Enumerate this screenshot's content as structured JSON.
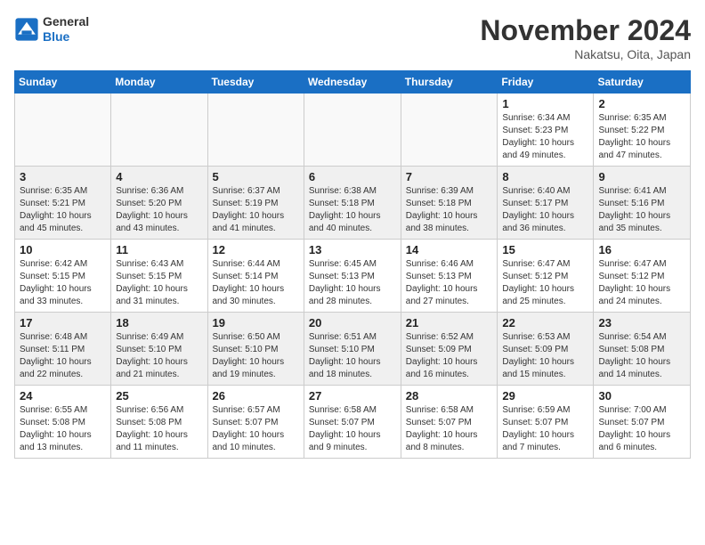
{
  "logo": {
    "general": "General",
    "blue": "Blue"
  },
  "header": {
    "month": "November 2024",
    "location": "Nakatsu, Oita, Japan"
  },
  "weekdays": [
    "Sunday",
    "Monday",
    "Tuesday",
    "Wednesday",
    "Thursday",
    "Friday",
    "Saturday"
  ],
  "weeks": [
    [
      {
        "day": "",
        "info": ""
      },
      {
        "day": "",
        "info": ""
      },
      {
        "day": "",
        "info": ""
      },
      {
        "day": "",
        "info": ""
      },
      {
        "day": "",
        "info": ""
      },
      {
        "day": "1",
        "info": "Sunrise: 6:34 AM\nSunset: 5:23 PM\nDaylight: 10 hours and 49 minutes."
      },
      {
        "day": "2",
        "info": "Sunrise: 6:35 AM\nSunset: 5:22 PM\nDaylight: 10 hours and 47 minutes."
      }
    ],
    [
      {
        "day": "3",
        "info": "Sunrise: 6:35 AM\nSunset: 5:21 PM\nDaylight: 10 hours and 45 minutes."
      },
      {
        "day": "4",
        "info": "Sunrise: 6:36 AM\nSunset: 5:20 PM\nDaylight: 10 hours and 43 minutes."
      },
      {
        "day": "5",
        "info": "Sunrise: 6:37 AM\nSunset: 5:19 PM\nDaylight: 10 hours and 41 minutes."
      },
      {
        "day": "6",
        "info": "Sunrise: 6:38 AM\nSunset: 5:18 PM\nDaylight: 10 hours and 40 minutes."
      },
      {
        "day": "7",
        "info": "Sunrise: 6:39 AM\nSunset: 5:18 PM\nDaylight: 10 hours and 38 minutes."
      },
      {
        "day": "8",
        "info": "Sunrise: 6:40 AM\nSunset: 5:17 PM\nDaylight: 10 hours and 36 minutes."
      },
      {
        "day": "9",
        "info": "Sunrise: 6:41 AM\nSunset: 5:16 PM\nDaylight: 10 hours and 35 minutes."
      }
    ],
    [
      {
        "day": "10",
        "info": "Sunrise: 6:42 AM\nSunset: 5:15 PM\nDaylight: 10 hours and 33 minutes."
      },
      {
        "day": "11",
        "info": "Sunrise: 6:43 AM\nSunset: 5:15 PM\nDaylight: 10 hours and 31 minutes."
      },
      {
        "day": "12",
        "info": "Sunrise: 6:44 AM\nSunset: 5:14 PM\nDaylight: 10 hours and 30 minutes."
      },
      {
        "day": "13",
        "info": "Sunrise: 6:45 AM\nSunset: 5:13 PM\nDaylight: 10 hours and 28 minutes."
      },
      {
        "day": "14",
        "info": "Sunrise: 6:46 AM\nSunset: 5:13 PM\nDaylight: 10 hours and 27 minutes."
      },
      {
        "day": "15",
        "info": "Sunrise: 6:47 AM\nSunset: 5:12 PM\nDaylight: 10 hours and 25 minutes."
      },
      {
        "day": "16",
        "info": "Sunrise: 6:47 AM\nSunset: 5:12 PM\nDaylight: 10 hours and 24 minutes."
      }
    ],
    [
      {
        "day": "17",
        "info": "Sunrise: 6:48 AM\nSunset: 5:11 PM\nDaylight: 10 hours and 22 minutes."
      },
      {
        "day": "18",
        "info": "Sunrise: 6:49 AM\nSunset: 5:10 PM\nDaylight: 10 hours and 21 minutes."
      },
      {
        "day": "19",
        "info": "Sunrise: 6:50 AM\nSunset: 5:10 PM\nDaylight: 10 hours and 19 minutes."
      },
      {
        "day": "20",
        "info": "Sunrise: 6:51 AM\nSunset: 5:10 PM\nDaylight: 10 hours and 18 minutes."
      },
      {
        "day": "21",
        "info": "Sunrise: 6:52 AM\nSunset: 5:09 PM\nDaylight: 10 hours and 16 minutes."
      },
      {
        "day": "22",
        "info": "Sunrise: 6:53 AM\nSunset: 5:09 PM\nDaylight: 10 hours and 15 minutes."
      },
      {
        "day": "23",
        "info": "Sunrise: 6:54 AM\nSunset: 5:08 PM\nDaylight: 10 hours and 14 minutes."
      }
    ],
    [
      {
        "day": "24",
        "info": "Sunrise: 6:55 AM\nSunset: 5:08 PM\nDaylight: 10 hours and 13 minutes."
      },
      {
        "day": "25",
        "info": "Sunrise: 6:56 AM\nSunset: 5:08 PM\nDaylight: 10 hours and 11 minutes."
      },
      {
        "day": "26",
        "info": "Sunrise: 6:57 AM\nSunset: 5:07 PM\nDaylight: 10 hours and 10 minutes."
      },
      {
        "day": "27",
        "info": "Sunrise: 6:58 AM\nSunset: 5:07 PM\nDaylight: 10 hours and 9 minutes."
      },
      {
        "day": "28",
        "info": "Sunrise: 6:58 AM\nSunset: 5:07 PM\nDaylight: 10 hours and 8 minutes."
      },
      {
        "day": "29",
        "info": "Sunrise: 6:59 AM\nSunset: 5:07 PM\nDaylight: 10 hours and 7 minutes."
      },
      {
        "day": "30",
        "info": "Sunrise: 7:00 AM\nSunset: 5:07 PM\nDaylight: 10 hours and 6 minutes."
      }
    ]
  ]
}
